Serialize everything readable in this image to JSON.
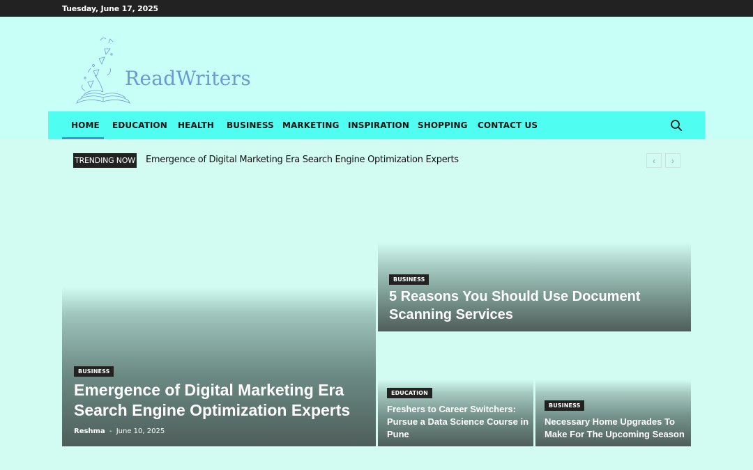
{
  "topbar": {
    "date": "Tuesday, June 17, 2025"
  },
  "logo": {
    "text": "ReadWriters"
  },
  "nav": {
    "items": [
      "HOME",
      "EDUCATION",
      "HEALTH",
      "BUSINESS",
      "MARKETING",
      "INSPIRATION",
      "SHOPPING",
      "CONTACT US"
    ],
    "active": "HOME",
    "search_icon": "search-icon"
  },
  "trending": {
    "label": "TRENDING NOW",
    "title": "Emergence of Digital Marketing Era Search Engine Optimization Experts",
    "prev": "‹",
    "next": "›"
  },
  "featured": {
    "main": {
      "category": "BUSINESS",
      "title_line1": "Emergence of Digital Marketing Era",
      "title_line2": "Search Engine Optimization Experts",
      "author": "Reshma",
      "separator": "-",
      "date": "June 10, 2025"
    },
    "right_top": {
      "category": "BUSINESS",
      "title_line1": "5 Reasons You Should Use Document",
      "title_line2": "Scanning Services"
    },
    "bottom_left": {
      "category": "EDUCATION",
      "title_line1": "Freshers to Career Switchers:",
      "title_line2": "Pursue a Data Science Course in",
      "title_line3": "Pune"
    },
    "bottom_right": {
      "category": "BUSINESS",
      "title_line1": "Necessary Home Upgrades To",
      "title_line2": "Make For The Upcoming Season"
    }
  },
  "colors": {
    "topbar": "#222222",
    "header": "#c8fff7",
    "nav": "#4ffdf1",
    "page": "#d2fcf2",
    "accent": "#4a8fd6",
    "logo": "#6a9ad6"
  }
}
